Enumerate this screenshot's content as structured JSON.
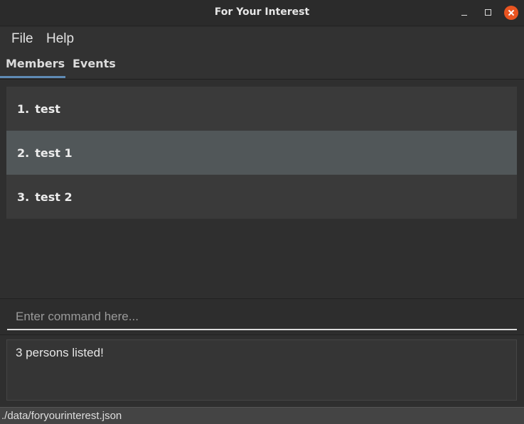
{
  "window": {
    "title": "For Your Interest"
  },
  "menu": {
    "items": [
      {
        "label": "File"
      },
      {
        "label": "Help"
      }
    ]
  },
  "tabs": [
    {
      "label": "Members",
      "selected": true
    },
    {
      "label": "Events",
      "selected": false
    }
  ],
  "members": [
    {
      "index": "1.",
      "name": "test",
      "selected": false
    },
    {
      "index": "2.",
      "name": "test 1",
      "selected": true
    },
    {
      "index": "3.",
      "name": "test 2",
      "selected": false
    }
  ],
  "command": {
    "value": "",
    "placeholder": "Enter command here..."
  },
  "result": {
    "text": "3 persons listed!"
  },
  "status": {
    "path": "./data/foryourinterest.json"
  },
  "colors": {
    "accent": "#5f8bb5",
    "close_button": "#e95420",
    "selected_row": "#515759"
  }
}
